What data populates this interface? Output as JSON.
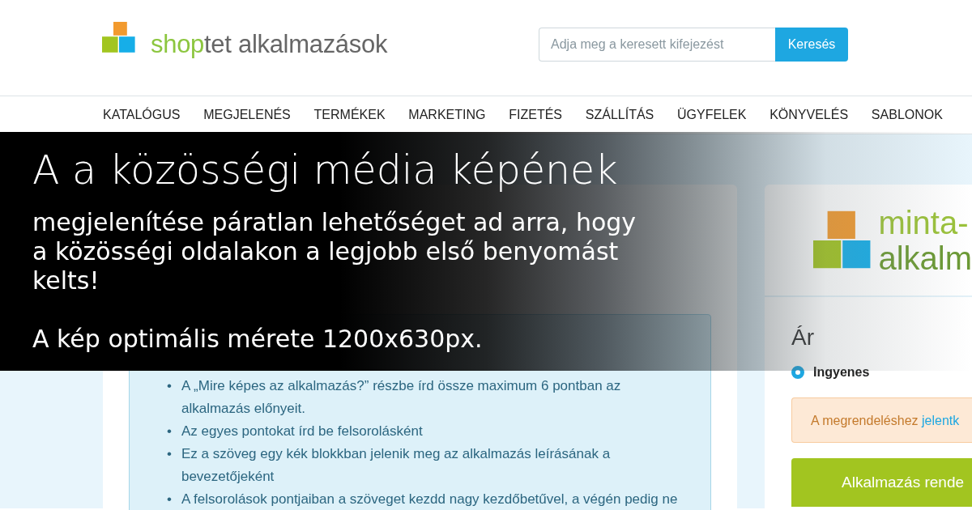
{
  "header": {
    "logo": {
      "part_1": "shop",
      "part_2": "tet",
      "part_3": "alkalmazások"
    },
    "search": {
      "placeholder": "Adja meg a keresett kifejezést",
      "button": "Keresés"
    }
  },
  "nav": [
    "KATALÓGUS",
    "MEGJELENÉS",
    "TERMÉKEK",
    "MARKETING",
    "FIZETÉS",
    "SZÁLLÍTÁS",
    "ÜGYFELEK",
    "KÖNYVELÉS",
    "SABLONOK"
  ],
  "banner": {
    "title": "A a közösségi média képének",
    "text": "megjelenítése páratlan lehetőséget ad arra, hogy a közösségi oldalakon a legjobb első benyomást kelts!",
    "note": "A kép optimális mérete 1200x630px."
  },
  "description": {
    "bullets": [
      {
        "marker": "•",
        "text": "A „Mire képes az alkalmazás?” részbe írd össze maximum 6 pontban az alkalmazás előnyeit."
      },
      {
        "marker": "•",
        "text": "Az egyes pontokat írd be felsorolásként"
      },
      {
        "marker": "•",
        "text": "Ez a szöveg egy kék blokkban jelenik meg az alkalmazás leírásának a bevezetőjeként"
      },
      {
        "marker": "•",
        "text": "A felsorolások pontjaiban a szöveget kezdd nagy kezdőbetűvel, a végén pedig ne"
      }
    ]
  },
  "sidebar": {
    "logo": {
      "line_1": "minta-",
      "line_2": "alkalm"
    },
    "price_label": "Ár",
    "price_options": [
      {
        "label": "Ingyenes",
        "selected": true
      }
    ],
    "notice": {
      "text": "A megrendeléshez ",
      "link": "jelentk"
    },
    "order_button": "Alkalmazás rende"
  }
}
